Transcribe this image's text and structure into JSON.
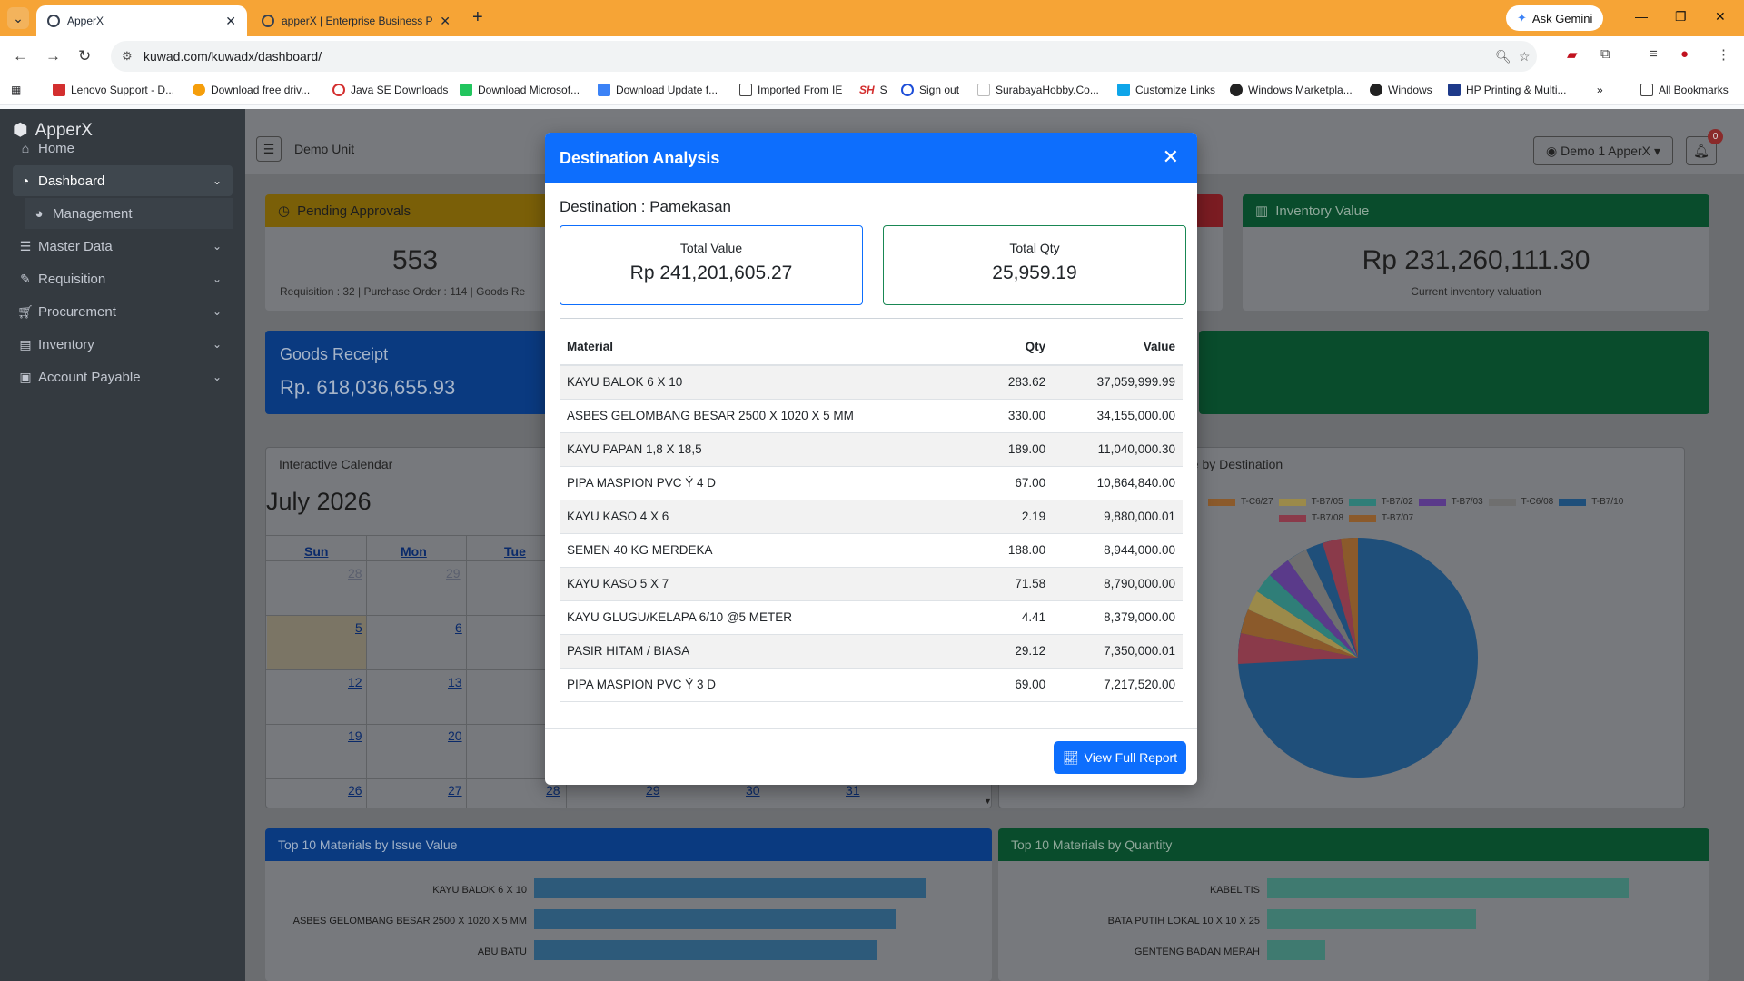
{
  "browser": {
    "tabs": [
      {
        "title": "ApperX"
      },
      {
        "title": "apperX | Enterprise Business Pla"
      }
    ],
    "gemini_label": "Ask Gemini",
    "url": "kuwad.com/kuwadx/dashboard/",
    "bookmarks": [
      "Lenovo Support - D...",
      "Download free driv...",
      "Java SE Downloads",
      "Download  Microsof...",
      "Download Update f...",
      "Imported From IE",
      "S",
      "Sign out",
      "SurabayaHobby.Co...",
      "Customize Links",
      "Windows Marketpla...",
      "Windows",
      "HP Printing & Multi..."
    ],
    "all_bookmarks": "All Bookmarks"
  },
  "sidebar": {
    "brand": "ApperX",
    "items": [
      {
        "label": "Home",
        "icon": "home-icon"
      },
      {
        "label": "Dashboard",
        "icon": "dashboard-icon"
      },
      {
        "label": "Management",
        "icon": "gauge-icon"
      },
      {
        "label": "Master Data",
        "icon": "database-icon"
      },
      {
        "label": "Requisition",
        "icon": "edit-icon"
      },
      {
        "label": "Procurement",
        "icon": "cart-icon"
      },
      {
        "label": "Inventory",
        "icon": "boxes-icon"
      },
      {
        "label": "Account Payable",
        "icon": "money-icon"
      }
    ]
  },
  "topbar": {
    "unit": "Demo Unit",
    "user": "Demo 1 ApperX",
    "notifications": "0"
  },
  "cards": {
    "pending": {
      "title": "Pending Approvals",
      "value": "553",
      "detail": "Requisition : 32 | Purchase Order : 114 | Goods Re"
    },
    "inventory": {
      "title": "Inventory Value",
      "value": "Rp 231,260,111.30",
      "detail": "Current inventory valuation"
    },
    "goods_receipt": {
      "title": "Goods Receipt",
      "value": "Rp. 618,036,655.93"
    }
  },
  "calendar": {
    "title": "Interactive Calendar",
    "month": "July 2026",
    "days_of_week": [
      "Sun",
      "Mon",
      "Tue"
    ],
    "rows": [
      [
        "28",
        "29"
      ],
      [
        "5",
        "6"
      ],
      [
        "12",
        "13"
      ],
      [
        "19",
        "20"
      ],
      [
        "26",
        "27",
        "28",
        "29",
        "30",
        "31"
      ]
    ]
  },
  "pie": {
    "title": "ue by Destination",
    "legend": [
      {
        "label": "T-C6/27",
        "color": "#8b5a2b"
      },
      {
        "label": "T-B7/05",
        "color": "#9b8a4a"
      },
      {
        "label": "T-B7/02",
        "color": "#2f7e78"
      },
      {
        "label": "T-B7/03",
        "color": "#5a3a8a"
      },
      {
        "label": "T-C6/08",
        "color": "#6f6f6f"
      },
      {
        "label": "T-B7/10",
        "color": "#1f4f7a"
      },
      {
        "label": "T-B7/08",
        "color": "#8a3a4a"
      },
      {
        "label": "T-B7/07",
        "color": "#8b5a2b"
      }
    ]
  },
  "bottom": {
    "issue_title": "Top 10 Materials by Issue Value",
    "issue_bars": [
      {
        "label": "KAYU BALOK 6 X 10",
        "value": 37059999.99
      },
      {
        "label": "ASBES GELOMBANG BESAR 2500 X 1020 X 5 MM",
        "value": 34155000
      },
      {
        "label": "ABU BATU",
        "value": 32000000
      }
    ],
    "qty_title": "Top 10 Materials by Quantity",
    "qty_bars": [
      {
        "label": "KABEL TIS",
        "value": 100
      },
      {
        "label": "BATA PUTIH LOKAL 10 X 10 X 25",
        "value": 58
      },
      {
        "label": "GENTENG BADAN MERAH",
        "value": 16
      }
    ]
  },
  "modal": {
    "title": "Destination Analysis",
    "destination": "Destination : Pamekasan",
    "total_value_label": "Total Value",
    "total_value": "Rp 241,201,605.27",
    "total_qty_label": "Total Qty",
    "total_qty": "25,959.19",
    "columns": {
      "material": "Material",
      "qty": "Qty",
      "value": "Value"
    },
    "rows": [
      {
        "material": "KAYU BALOK 6 X 10",
        "qty": "283.62",
        "value": "37,059,999.99"
      },
      {
        "material": "ASBES GELOMBANG BESAR 2500 X 1020 X 5 MM",
        "qty": "330.00",
        "value": "34,155,000.00"
      },
      {
        "material": "KAYU PAPAN 1,8 X 18,5",
        "qty": "189.00",
        "value": "11,040,000.30"
      },
      {
        "material": "PIPA MASPION PVC Ý 4 D",
        "qty": "67.00",
        "value": "10,864,840.00"
      },
      {
        "material": "KAYU KASO 4 X 6",
        "qty": "2.19",
        "value": "9,880,000.01"
      },
      {
        "material": "SEMEN 40 KG MERDEKA",
        "qty": "188.00",
        "value": "8,944,000.00"
      },
      {
        "material": "KAYU KASO 5 X 7",
        "qty": "71.58",
        "value": "8,790,000.00"
      },
      {
        "material": "KAYU GLUGU/KELAPA 6/10 @5 METER",
        "qty": "4.41",
        "value": "8,379,000.00"
      },
      {
        "material": "PASIR HITAM / BIASA",
        "qty": "29.12",
        "value": "7,350,000.01"
      },
      {
        "material": "PIPA MASPION PVC Ý 3 D",
        "qty": "69.00",
        "value": "7,217,520.00"
      }
    ],
    "report_button": "View Full Report"
  },
  "colors": {
    "primary": "#0d6efd",
    "success": "#198754",
    "sidebar": "#343a40",
    "browser_frame": "#f6a436"
  }
}
